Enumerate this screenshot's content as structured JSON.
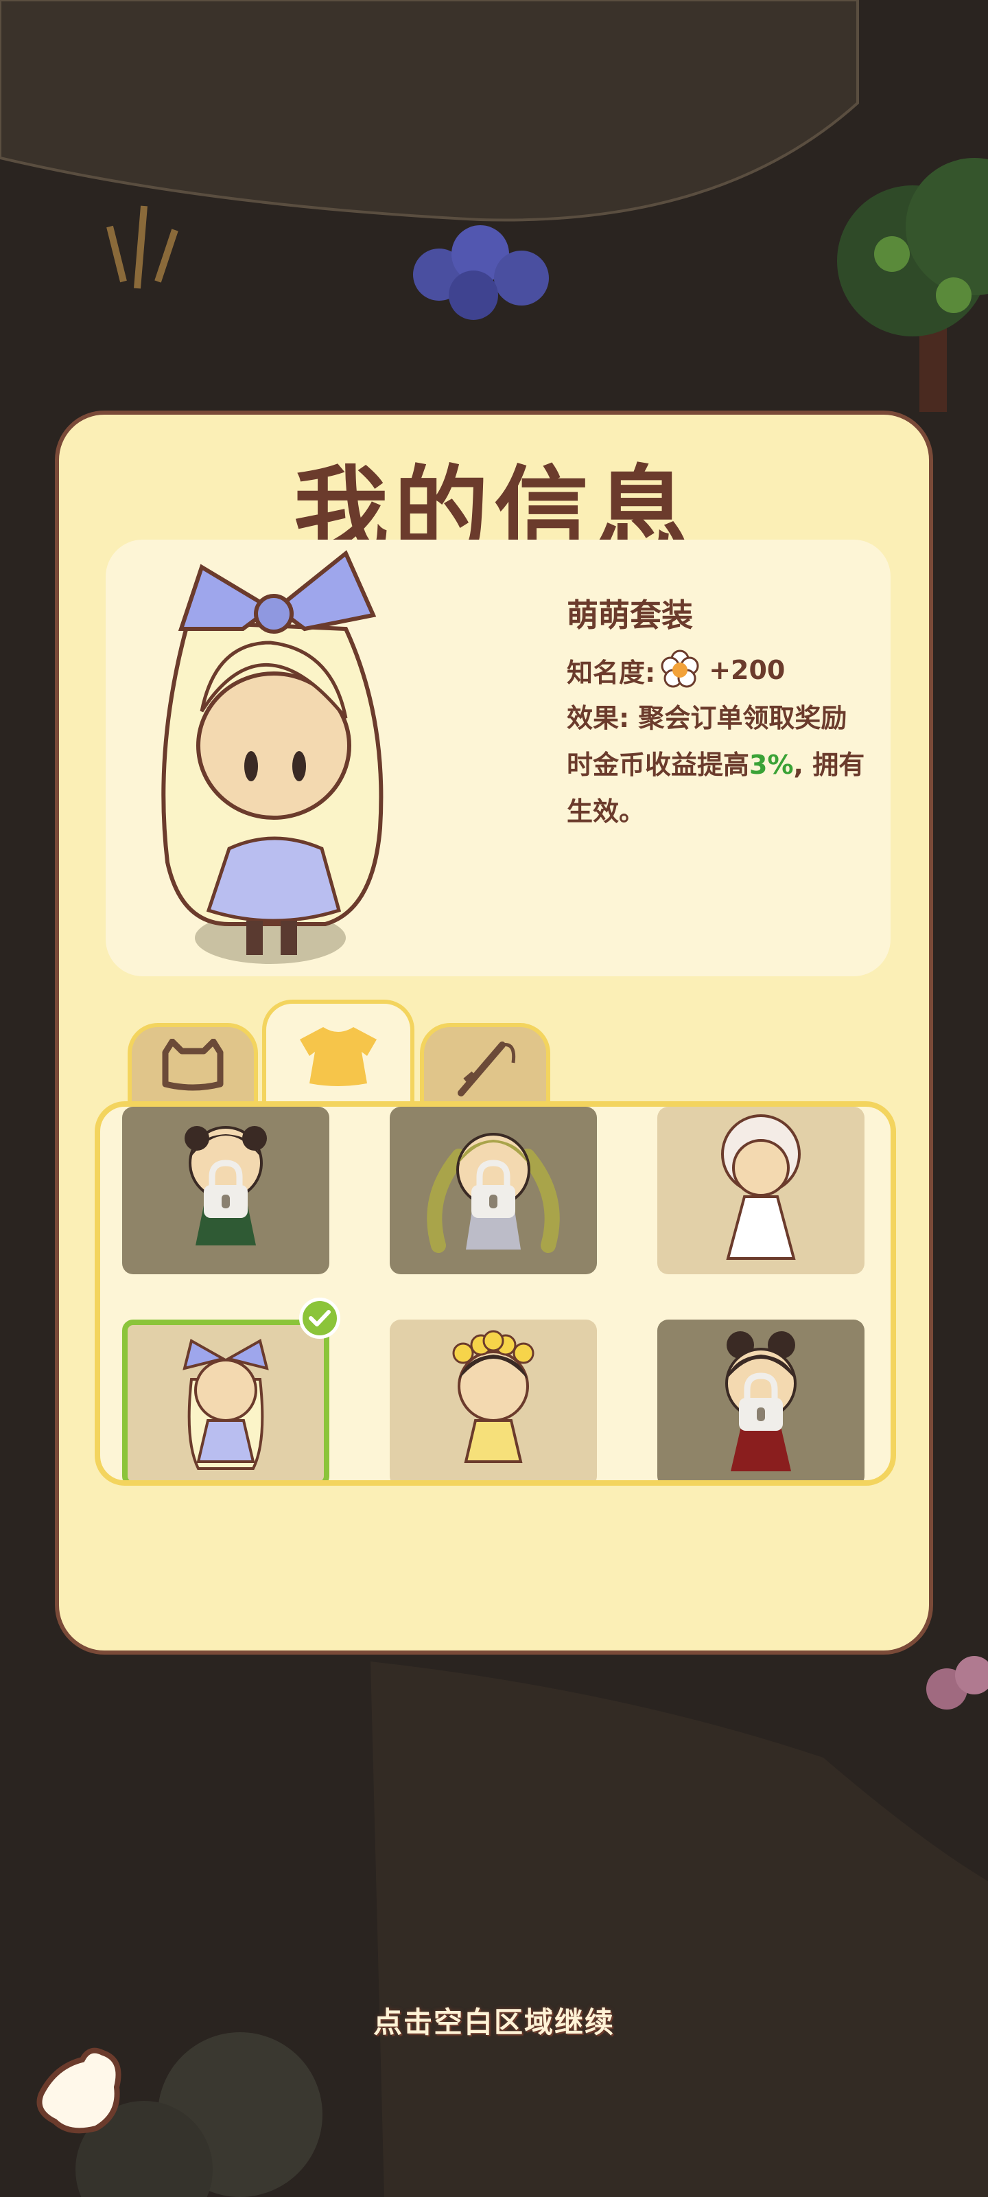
{
  "modal": {
    "title": "我的信息",
    "outfit": {
      "name": "萌萌套装",
      "fame_label": "知名度:",
      "fame_value": "+200",
      "effect_prefix": "效果: 聚会订单领取奖励时金币收益提高",
      "effect_bonus": "3%",
      "effect_suffix": ", 拥有生效。"
    },
    "tabs": [
      {
        "icon": "cat-head-icon",
        "active": false
      },
      {
        "icon": "dress-icon",
        "active": true
      },
      {
        "icon": "fishing-rod-icon",
        "active": false
      }
    ],
    "outfits": [
      {
        "icon": "red-outfit-character-icon",
        "locked": true,
        "selected": false
      },
      {
        "icon": "green-twin-tail-character-icon",
        "locked": true,
        "selected": false
      },
      {
        "icon": "white-bride-character-icon",
        "locked": false,
        "selected": false
      },
      {
        "icon": "blue-bow-character-icon",
        "locked": false,
        "selected": true
      },
      {
        "icon": "yellow-flower-character-icon",
        "locked": false,
        "selected": false
      },
      {
        "icon": "red-hanfu-character-icon",
        "locked": true,
        "selected": false
      }
    ]
  },
  "hint": "点击空白区域继续",
  "colors": {
    "panel": "#fbefb6",
    "border": "#7a4a38",
    "title": "#6b3b2c",
    "accent_green": "#3aa236",
    "selected_border": "#8bc43a",
    "tab_border": "#f3d45e"
  }
}
